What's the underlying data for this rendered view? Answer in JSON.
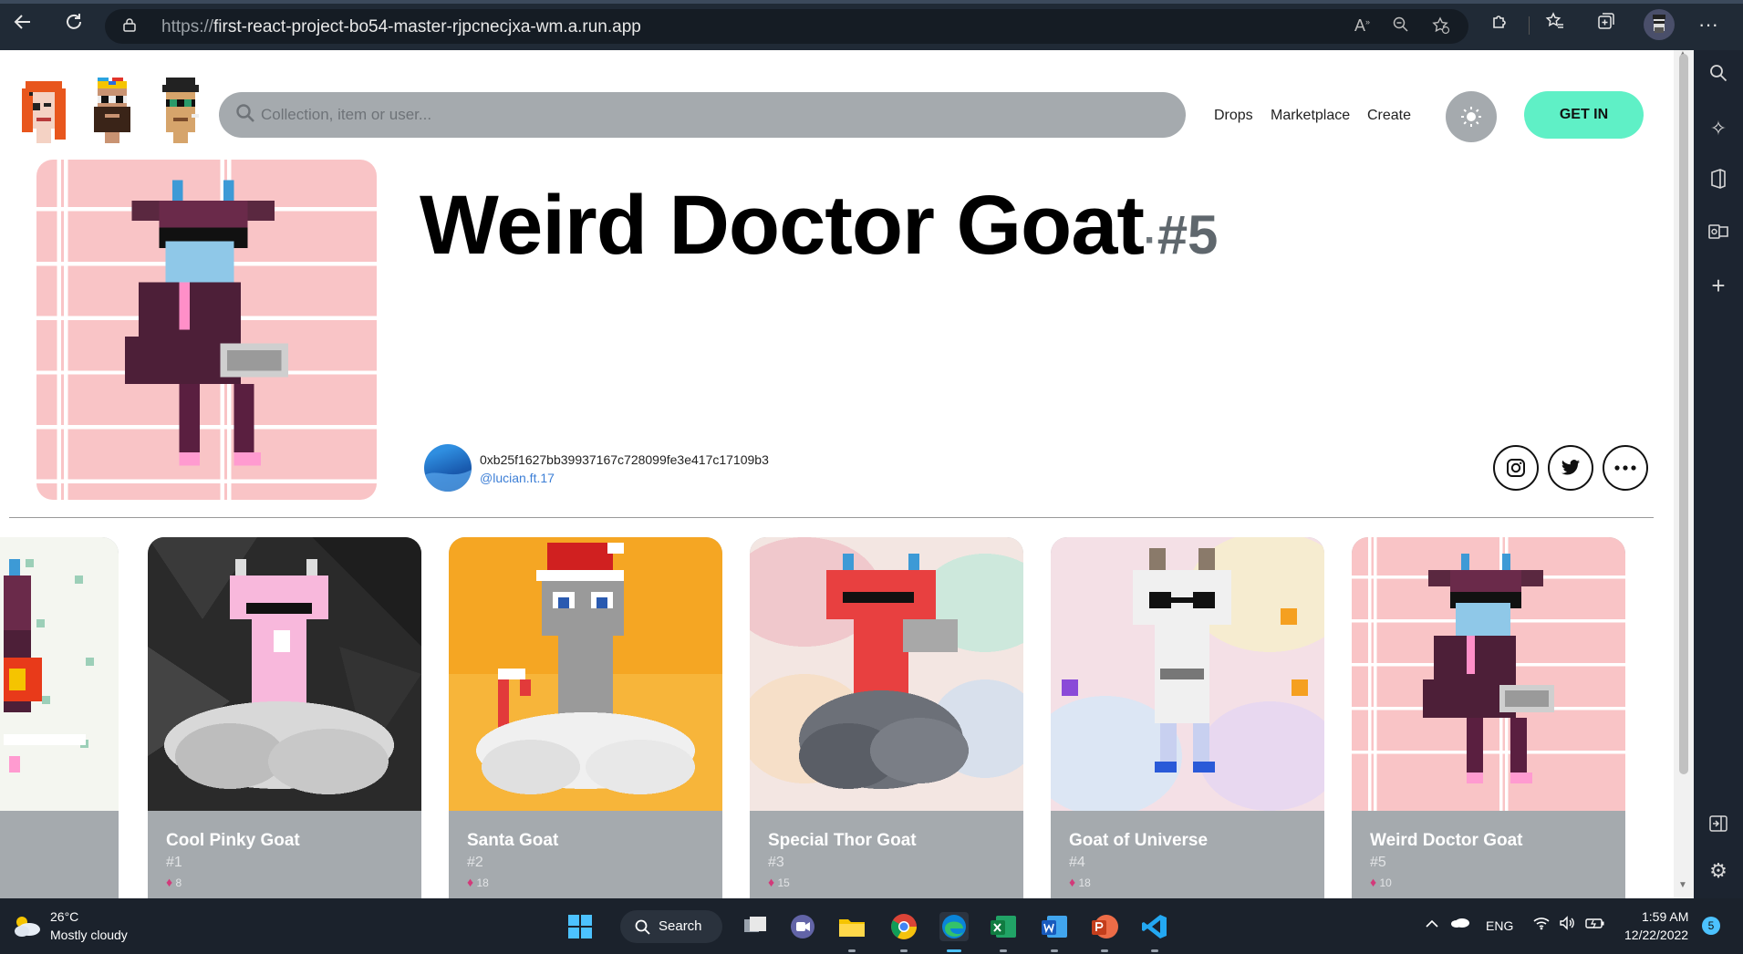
{
  "browser": {
    "url_prefix": "https://",
    "url_host": "first-react-project-bo54-master-rjpcnecjxa-wm.a.run.app"
  },
  "header": {
    "search_placeholder": "Collection, item or user...",
    "nav": [
      "Drops",
      "Marketplace",
      "Create"
    ],
    "cta_label": "GET IN"
  },
  "hero": {
    "title": "Weird Doctor Goat",
    "separator": "·",
    "number": "#5",
    "owner_address": "0xb25f1627bb39937167c728099fe3e417c17109b3",
    "owner_handle": "@lucian.ft.17"
  },
  "cards": [
    {
      "name": "Cool Pinky Goat",
      "number": "#1",
      "likes": "8"
    },
    {
      "name": "Santa Goat",
      "number": "#2",
      "likes": "18"
    },
    {
      "name": "Special Thor Goat",
      "number": "#3",
      "likes": "15"
    },
    {
      "name": "Goat of Universe",
      "number": "#4",
      "likes": "18"
    },
    {
      "name": "Weird Doctor Goat",
      "number": "#5",
      "likes": "10"
    }
  ],
  "taskbar": {
    "temperature": "26°C",
    "weather": "Mostly cloudy",
    "search_label": "Search",
    "language": "ENG",
    "time": "1:59 AM",
    "date": "12/22/2022",
    "notifications": "5"
  },
  "colors": {
    "accent": "#5ff0c6",
    "card_footer": "#a5aaae",
    "pink_bg": "#f9c4c6"
  }
}
